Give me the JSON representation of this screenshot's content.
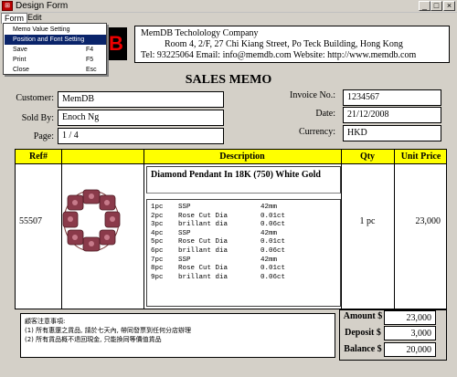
{
  "window": {
    "title": "Design Form",
    "app_icon": "form-icon"
  },
  "menu": {
    "items": [
      "Form",
      "Edit"
    ]
  },
  "dropdown": {
    "items": [
      {
        "label": "Memo Value Setting",
        "key": ""
      },
      {
        "label": "Position and Font Setting",
        "key": ""
      },
      {
        "label": "Save",
        "key": "F4"
      },
      {
        "label": "Print",
        "key": "F5"
      },
      {
        "label": "Close",
        "key": "Esc"
      }
    ],
    "selected_index": 1
  },
  "company": {
    "name": "MemDB Techolology Company",
    "address": "Room 4, 2/F, 27 Chi Kiang Street, Po Teck Building, Hong Kong",
    "contact": "Tel: 93225064   Email: info@memdb.com   Website: http://www.memdb.com",
    "logo_letter": "B"
  },
  "memo_title": "SALES MEMO",
  "customer": {
    "label": "Customer:",
    "value": "MemDB"
  },
  "sold_by": {
    "label": "Sold By:",
    "value": "Enoch Ng"
  },
  "page": {
    "label": "Page:",
    "value": "1 / 4"
  },
  "invoice_no": {
    "label": "Invoice No.:",
    "value": "1234567"
  },
  "date": {
    "label": "Date:",
    "value": "21/12/2008"
  },
  "currency": {
    "label": "Currency:",
    "value": "HKD"
  },
  "table": {
    "headers": {
      "ref": "Ref#",
      "description": "Description",
      "qty": "Qty",
      "unit_price": "Unit Price"
    },
    "row": {
      "ref": "55507",
      "title": "Diamond Pendant In 18K (750) White Gold",
      "qty": "1 pc",
      "unit_price": "23,000",
      "specs": [
        [
          "1pc",
          "SSP",
          "42mm"
        ],
        [
          "2pc",
          "Rose Cut Dia",
          "0.01ct"
        ],
        [
          "3pc",
          "brillant dia",
          "0.06ct"
        ],
        [
          "4pc",
          "SSP",
          "42mm"
        ],
        [
          "5pc",
          "Rose Cut Dia",
          "0.01ct"
        ],
        [
          "6pc",
          "brillant dia",
          "0.06ct"
        ],
        [
          "7pc",
          "SSP",
          "42mm"
        ],
        [
          "8pc",
          "Rose Cut Dia",
          "0.01ct"
        ],
        [
          "9pc",
          "brillant dia",
          "0.06ct"
        ]
      ]
    }
  },
  "notes": {
    "title": "顧客注意事項:",
    "lines": [
      "(1) 所有惠還之貨品, 請於七天內, 帶同發票到任何分店辦理",
      "(2) 所有貨品概不退回現金, 只能換同等價值貨品"
    ]
  },
  "totals": {
    "amount": {
      "label": "Amount $",
      "value": "23,000"
    },
    "deposit": {
      "label": "Deposit $",
      "value": "3,000"
    },
    "balance": {
      "label": "Balance $",
      "value": "20,000"
    }
  },
  "colors": {
    "header_yellow": "#ffff00",
    "menu_highlight": "#0a246a",
    "logo_red": "#ee0000"
  }
}
